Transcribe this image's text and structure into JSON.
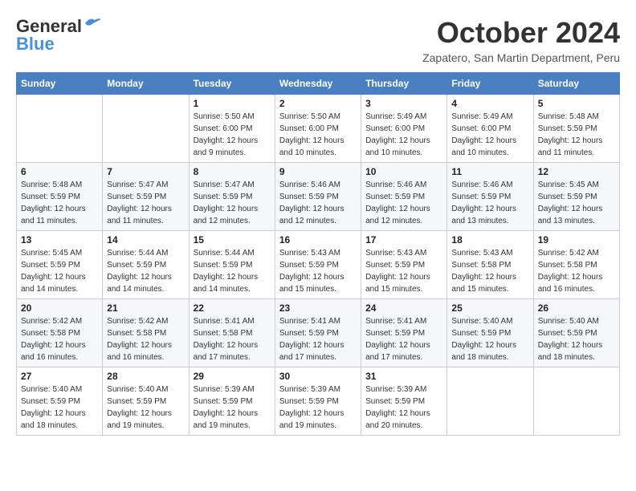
{
  "header": {
    "logo_line1": "General",
    "logo_line2": "Blue",
    "month": "October 2024",
    "location": "Zapatero, San Martin Department, Peru"
  },
  "weekdays": [
    "Sunday",
    "Monday",
    "Tuesday",
    "Wednesday",
    "Thursday",
    "Friday",
    "Saturday"
  ],
  "weeks": [
    [
      {
        "day": "",
        "detail": ""
      },
      {
        "day": "",
        "detail": ""
      },
      {
        "day": "1",
        "detail": "Sunrise: 5:50 AM\nSunset: 6:00 PM\nDaylight: 12 hours and 9 minutes."
      },
      {
        "day": "2",
        "detail": "Sunrise: 5:50 AM\nSunset: 6:00 PM\nDaylight: 12 hours and 10 minutes."
      },
      {
        "day": "3",
        "detail": "Sunrise: 5:49 AM\nSunset: 6:00 PM\nDaylight: 12 hours and 10 minutes."
      },
      {
        "day": "4",
        "detail": "Sunrise: 5:49 AM\nSunset: 6:00 PM\nDaylight: 12 hours and 10 minutes."
      },
      {
        "day": "5",
        "detail": "Sunrise: 5:48 AM\nSunset: 5:59 PM\nDaylight: 12 hours and 11 minutes."
      }
    ],
    [
      {
        "day": "6",
        "detail": "Sunrise: 5:48 AM\nSunset: 5:59 PM\nDaylight: 12 hours and 11 minutes."
      },
      {
        "day": "7",
        "detail": "Sunrise: 5:47 AM\nSunset: 5:59 PM\nDaylight: 12 hours and 11 minutes."
      },
      {
        "day": "8",
        "detail": "Sunrise: 5:47 AM\nSunset: 5:59 PM\nDaylight: 12 hours and 12 minutes."
      },
      {
        "day": "9",
        "detail": "Sunrise: 5:46 AM\nSunset: 5:59 PM\nDaylight: 12 hours and 12 minutes."
      },
      {
        "day": "10",
        "detail": "Sunrise: 5:46 AM\nSunset: 5:59 PM\nDaylight: 12 hours and 12 minutes."
      },
      {
        "day": "11",
        "detail": "Sunrise: 5:46 AM\nSunset: 5:59 PM\nDaylight: 12 hours and 13 minutes."
      },
      {
        "day": "12",
        "detail": "Sunrise: 5:45 AM\nSunset: 5:59 PM\nDaylight: 12 hours and 13 minutes."
      }
    ],
    [
      {
        "day": "13",
        "detail": "Sunrise: 5:45 AM\nSunset: 5:59 PM\nDaylight: 12 hours and 14 minutes."
      },
      {
        "day": "14",
        "detail": "Sunrise: 5:44 AM\nSunset: 5:59 PM\nDaylight: 12 hours and 14 minutes."
      },
      {
        "day": "15",
        "detail": "Sunrise: 5:44 AM\nSunset: 5:59 PM\nDaylight: 12 hours and 14 minutes."
      },
      {
        "day": "16",
        "detail": "Sunrise: 5:43 AM\nSunset: 5:59 PM\nDaylight: 12 hours and 15 minutes."
      },
      {
        "day": "17",
        "detail": "Sunrise: 5:43 AM\nSunset: 5:59 PM\nDaylight: 12 hours and 15 minutes."
      },
      {
        "day": "18",
        "detail": "Sunrise: 5:43 AM\nSunset: 5:58 PM\nDaylight: 12 hours and 15 minutes."
      },
      {
        "day": "19",
        "detail": "Sunrise: 5:42 AM\nSunset: 5:58 PM\nDaylight: 12 hours and 16 minutes."
      }
    ],
    [
      {
        "day": "20",
        "detail": "Sunrise: 5:42 AM\nSunset: 5:58 PM\nDaylight: 12 hours and 16 minutes."
      },
      {
        "day": "21",
        "detail": "Sunrise: 5:42 AM\nSunset: 5:58 PM\nDaylight: 12 hours and 16 minutes."
      },
      {
        "day": "22",
        "detail": "Sunrise: 5:41 AM\nSunset: 5:58 PM\nDaylight: 12 hours and 17 minutes."
      },
      {
        "day": "23",
        "detail": "Sunrise: 5:41 AM\nSunset: 5:59 PM\nDaylight: 12 hours and 17 minutes."
      },
      {
        "day": "24",
        "detail": "Sunrise: 5:41 AM\nSunset: 5:59 PM\nDaylight: 12 hours and 17 minutes."
      },
      {
        "day": "25",
        "detail": "Sunrise: 5:40 AM\nSunset: 5:59 PM\nDaylight: 12 hours and 18 minutes."
      },
      {
        "day": "26",
        "detail": "Sunrise: 5:40 AM\nSunset: 5:59 PM\nDaylight: 12 hours and 18 minutes."
      }
    ],
    [
      {
        "day": "27",
        "detail": "Sunrise: 5:40 AM\nSunset: 5:59 PM\nDaylight: 12 hours and 18 minutes."
      },
      {
        "day": "28",
        "detail": "Sunrise: 5:40 AM\nSunset: 5:59 PM\nDaylight: 12 hours and 19 minutes."
      },
      {
        "day": "29",
        "detail": "Sunrise: 5:39 AM\nSunset: 5:59 PM\nDaylight: 12 hours and 19 minutes."
      },
      {
        "day": "30",
        "detail": "Sunrise: 5:39 AM\nSunset: 5:59 PM\nDaylight: 12 hours and 19 minutes."
      },
      {
        "day": "31",
        "detail": "Sunrise: 5:39 AM\nSunset: 5:59 PM\nDaylight: 12 hours and 20 minutes."
      },
      {
        "day": "",
        "detail": ""
      },
      {
        "day": "",
        "detail": ""
      }
    ]
  ]
}
